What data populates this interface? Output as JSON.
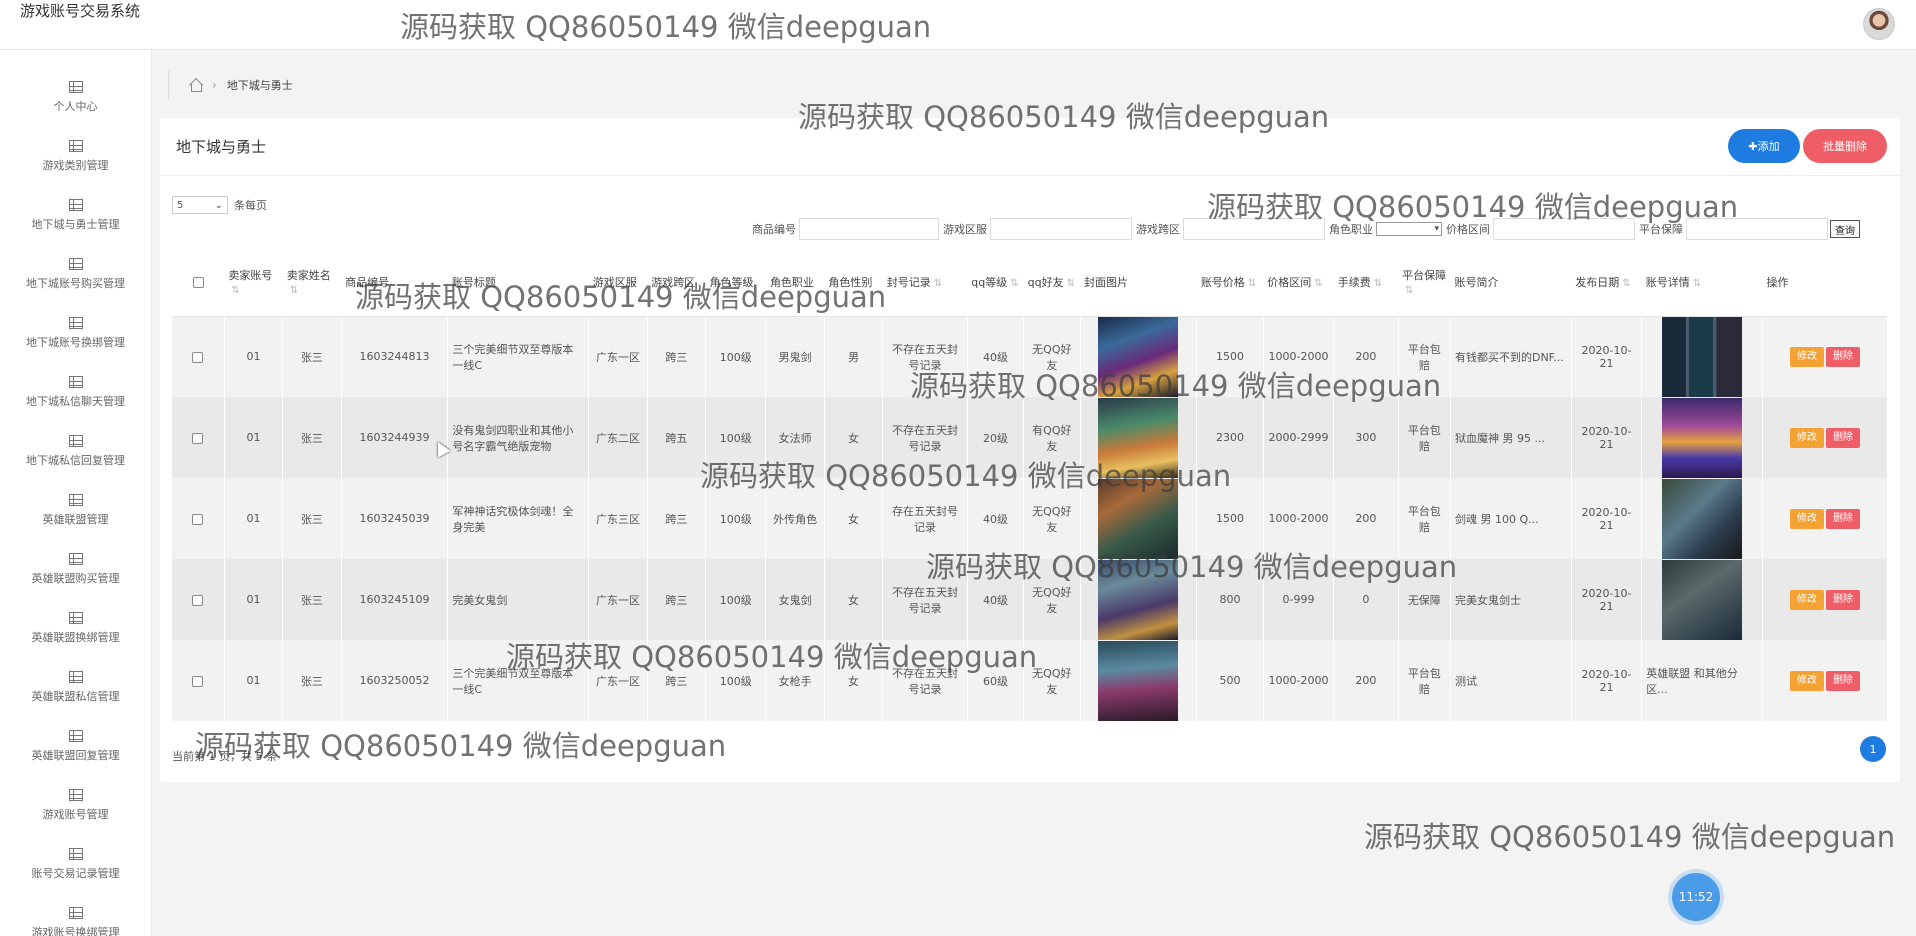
{
  "app": {
    "title": "游戏账号交易系统"
  },
  "sidebar": {
    "items": [
      {
        "label": "个人中心"
      },
      {
        "label": "游戏类别管理"
      },
      {
        "label": "地下城与勇士管理"
      },
      {
        "label": "地下城账号购买管理"
      },
      {
        "label": "地下城账号换绑管理"
      },
      {
        "label": "地下城私信聊天管理"
      },
      {
        "label": "地下城私信回复管理"
      },
      {
        "label": "英雄联盟管理"
      },
      {
        "label": "英雄联盟购买管理"
      },
      {
        "label": "英雄联盟换绑管理"
      },
      {
        "label": "英雄联盟私信管理"
      },
      {
        "label": "英雄联盟回复管理"
      },
      {
        "label": "游戏账号管理"
      },
      {
        "label": "账号交易记录管理"
      },
      {
        "label": "游戏账号换绑管理"
      }
    ]
  },
  "breadcrumb": {
    "current": "地下城与勇士"
  },
  "card": {
    "title": "地下城与勇士",
    "add_label": "✚添加",
    "batch_delete_label": "批量删除",
    "page_size": "5",
    "page_size_suffix": "条每页"
  },
  "filters": {
    "product_no": "商品编号",
    "server": "游戏区服",
    "cross_server": "游戏跨区",
    "role_job": "角色职业",
    "price_range": "价格区间",
    "guarantee": "平台保障",
    "query": "查询"
  },
  "table": {
    "headers": [
      "卖家账号",
      "卖家姓名",
      "商品编号",
      "账号标题",
      "游戏区服",
      "游戏跨区",
      "角色等级",
      "角色职业",
      "角色性别",
      "封号记录",
      "qq等级",
      "qq好友",
      "封面图片",
      "账号价格",
      "价格区间",
      "手续费",
      "平台保障",
      "账号简介",
      "发布日期",
      "账号详情",
      "操作"
    ],
    "rows": [
      {
        "seller": "01",
        "name": "张三",
        "no": "1603244813",
        "title": "三个完美细节双至尊版本一线C",
        "server": "广东一区",
        "cross": "跨三",
        "level": "100级",
        "job": "男鬼剑",
        "gender": "男",
        "ban": "不存在五天封号记录",
        "qq_level": "40级",
        "qq_friend": "无QQ好友",
        "price": "1500",
        "range": "1000-2000",
        "fee": "200",
        "guarantee": "平台包赔",
        "intro": "有钱都买不到的DNF...",
        "date": "2020-10-21",
        "detail": ""
      },
      {
        "seller": "01",
        "name": "张三",
        "no": "1603244939",
        "title": "没有鬼剑四职业和其他小号名字霸气绝版宠物",
        "server": "广东二区",
        "cross": "跨五",
        "level": "100级",
        "job": "女法师",
        "gender": "女",
        "ban": "不存在五天封号记录",
        "qq_level": "20级",
        "qq_friend": "有QQ好友",
        "price": "2300",
        "range": "2000-2999",
        "fee": "300",
        "guarantee": "平台包赔",
        "intro": "狱血魔神 男 95 ...",
        "date": "2020-10-21",
        "detail": ""
      },
      {
        "seller": "01",
        "name": "张三",
        "no": "1603245039",
        "title": "军神神话究极体剑魂！全身完美",
        "server": "广东三区",
        "cross": "跨三",
        "level": "100级",
        "job": "外传角色",
        "gender": "女",
        "ban": "存在五天封号记录",
        "qq_level": "40级",
        "qq_friend": "无QQ好友",
        "price": "1500",
        "range": "1000-2000",
        "fee": "200",
        "guarantee": "平台包赔",
        "intro": "剑魂 男 100 Q...",
        "date": "2020-10-21",
        "detail": ""
      },
      {
        "seller": "01",
        "name": "张三",
        "no": "1603245109",
        "title": "完美女鬼剑",
        "server": "广东一区",
        "cross": "跨三",
        "level": "100级",
        "job": "女鬼剑",
        "gender": "女",
        "ban": "不存在五天封号记录",
        "qq_level": "40级",
        "qq_friend": "无QQ好友",
        "price": "800",
        "range": "0-999",
        "fee": "0",
        "guarantee": "无保障",
        "intro": "完美女鬼剑士",
        "date": "2020-10-21",
        "detail": ""
      },
      {
        "seller": "01",
        "name": "张三",
        "no": "1603250052",
        "title": "三个完美细节双至尊版本一线C",
        "server": "广东一区",
        "cross": "跨三",
        "level": "100级",
        "job": "女枪手",
        "gender": "女",
        "ban": "不存在五天封号记录",
        "qq_level": "60级",
        "qq_friend": "无QQ好友",
        "price": "500",
        "range": "1000-2000",
        "fee": "200",
        "guarantee": "平台包赔",
        "intro": "测试",
        "date": "2020-10-21",
        "detail": "英雄联盟 和其他分区..."
      }
    ],
    "edit_label": "修改",
    "delete_label": "删除"
  },
  "pagination": {
    "total_text": "当前第 1 页，共 5 条",
    "current_page": "1"
  },
  "clock": {
    "time": "11:52"
  },
  "watermark": {
    "text": "源码获取 QQ86050149 微信deepguan"
  },
  "icons": {
    "home": "home-icon",
    "chevron": "chevron-right-icon",
    "menu": "table-grid-icon"
  },
  "colors": {
    "primary": "#1e7be0",
    "danger": "#ef5d67",
    "warning": "#f5a235"
  }
}
